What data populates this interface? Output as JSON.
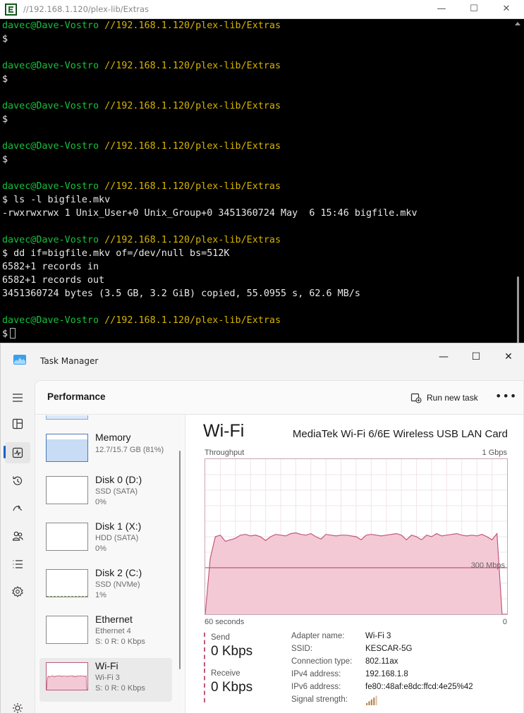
{
  "terminal": {
    "title": "//192.168.1.120/plex-lib/Extras",
    "controls": {
      "minimize": "—",
      "maximize": "☐",
      "close": "✕"
    },
    "prompt_user": "davec@Dave-Vostro",
    "prompt_path": "//192.168.1.120/plex-lib/Extras",
    "prompt_symbol": "$",
    "commands": {
      "ls": " ls -l bigfile.mkv",
      "dd": " dd if=bigfile.mkv of=/dev/null bs=512K"
    },
    "output": {
      "ls_line": "-rwxrwxrwx 1 Unix_User+0 Unix_Group+0 3451360724 May  6 15:46 bigfile.mkv",
      "dd_in": "6582+1 records in",
      "dd_out": "6582+1 records out",
      "dd_summary": "3451360724 bytes (3.5 GB, 3.2 GiB) copied, 55.0955 s, 62.6 MB/s"
    }
  },
  "task_manager": {
    "title": "Task Manager",
    "controls": {
      "minimize": "—",
      "maximize": "☐",
      "close": "✕"
    },
    "nav_icons": [
      "hamburger-icon",
      "processes-icon",
      "performance-icon",
      "app-history-icon",
      "startup-apps-icon",
      "users-icon",
      "details-icon",
      "services-icon",
      "settings-icon"
    ],
    "header": {
      "title": "Performance",
      "run_task_label": "Run new task",
      "more_label": "•••"
    },
    "resources": {
      "memory": {
        "name": "Memory",
        "sub1": "12.7/15.7 GB (81%)"
      },
      "disk0": {
        "name": "Disk 0 (D:)",
        "sub1": "SSD (SATA)",
        "sub2": "0%"
      },
      "disk1": {
        "name": "Disk 1 (X:)",
        "sub1": "HDD (SATA)",
        "sub2": "0%"
      },
      "disk2": {
        "name": "Disk 2 (C:)",
        "sub1": "SSD (NVMe)",
        "sub2": "1%"
      },
      "ethernet": {
        "name": "Ethernet",
        "sub1": "Ethernet 4",
        "sub2": "S: 0 R: 0 Kbps"
      },
      "wifi": {
        "name": "Wi-Fi",
        "sub1": "Wi-Fi 3",
        "sub2": "S: 0 R: 0 Kbps"
      }
    },
    "memory_usage_fraction": 0.81,
    "detail": {
      "heading": "Wi-Fi",
      "adapter": "MediaTek Wi-Fi 6/6E Wireless USB LAN Card",
      "throughput_label": "Throughput",
      "max_label": "1 Gbps",
      "time_label": "60 seconds",
      "zero_label": "0",
      "scale_label": "300 Mbps",
      "send_label": "Send",
      "send_value": "0 Kbps",
      "receive_label": "Receive",
      "receive_value": "0 Kbps",
      "info": [
        {
          "k": "Adapter name:",
          "v": "Wi-Fi 3"
        },
        {
          "k": "SSID:",
          "v": "KESCAR-5G"
        },
        {
          "k": "Connection type:",
          "v": "802.11ax"
        },
        {
          "k": "IPv4 address:",
          "v": "192.168.1.8"
        },
        {
          "k": "IPv6 address:",
          "v": "fe80::48af:e8dc:ffcd:4e25%42"
        },
        {
          "k": "Signal strength:",
          "v": ""
        }
      ],
      "signal_bars_lit": 4,
      "signal_bars_total": 5
    },
    "colors": {
      "accent": "#0067c0",
      "wifi_fill": "#f4c9d6",
      "wifi_line": "#c0587a",
      "memory_fill": "#c9dcf5"
    },
    "chart_data": {
      "type": "area",
      "ylabel": "Throughput",
      "ylim": [
        0,
        1000
      ],
      "x": [
        60,
        59,
        58,
        57,
        56,
        55,
        54,
        53,
        52,
        51,
        50,
        49,
        48,
        47,
        46,
        45,
        44,
        43,
        42,
        41,
        40,
        39,
        38,
        37,
        36,
        35,
        34,
        33,
        32,
        31,
        30,
        29,
        28,
        27,
        26,
        25,
        24,
        23,
        22,
        21,
        20,
        19,
        18,
        17,
        16,
        15,
        14,
        13,
        12,
        11,
        10,
        9,
        8,
        7,
        6,
        5,
        4,
        3,
        2,
        1,
        0
      ],
      "series": [
        {
          "values": [
            0,
            360,
            500,
            510,
            470,
            480,
            490,
            510,
            515,
            505,
            510,
            500,
            475,
            500,
            515,
            510,
            505,
            520,
            525,
            515,
            510,
            520,
            500,
            485,
            515,
            510,
            505,
            510,
            510,
            505,
            500,
            480,
            510,
            515,
            510,
            505,
            510,
            515,
            520,
            510,
            480,
            510,
            500,
            480,
            510,
            500,
            520,
            505,
            510,
            515,
            520,
            510,
            505,
            510,
            505,
            515,
            500,
            480,
            520,
            0,
            0
          ]
        }
      ]
    }
  }
}
